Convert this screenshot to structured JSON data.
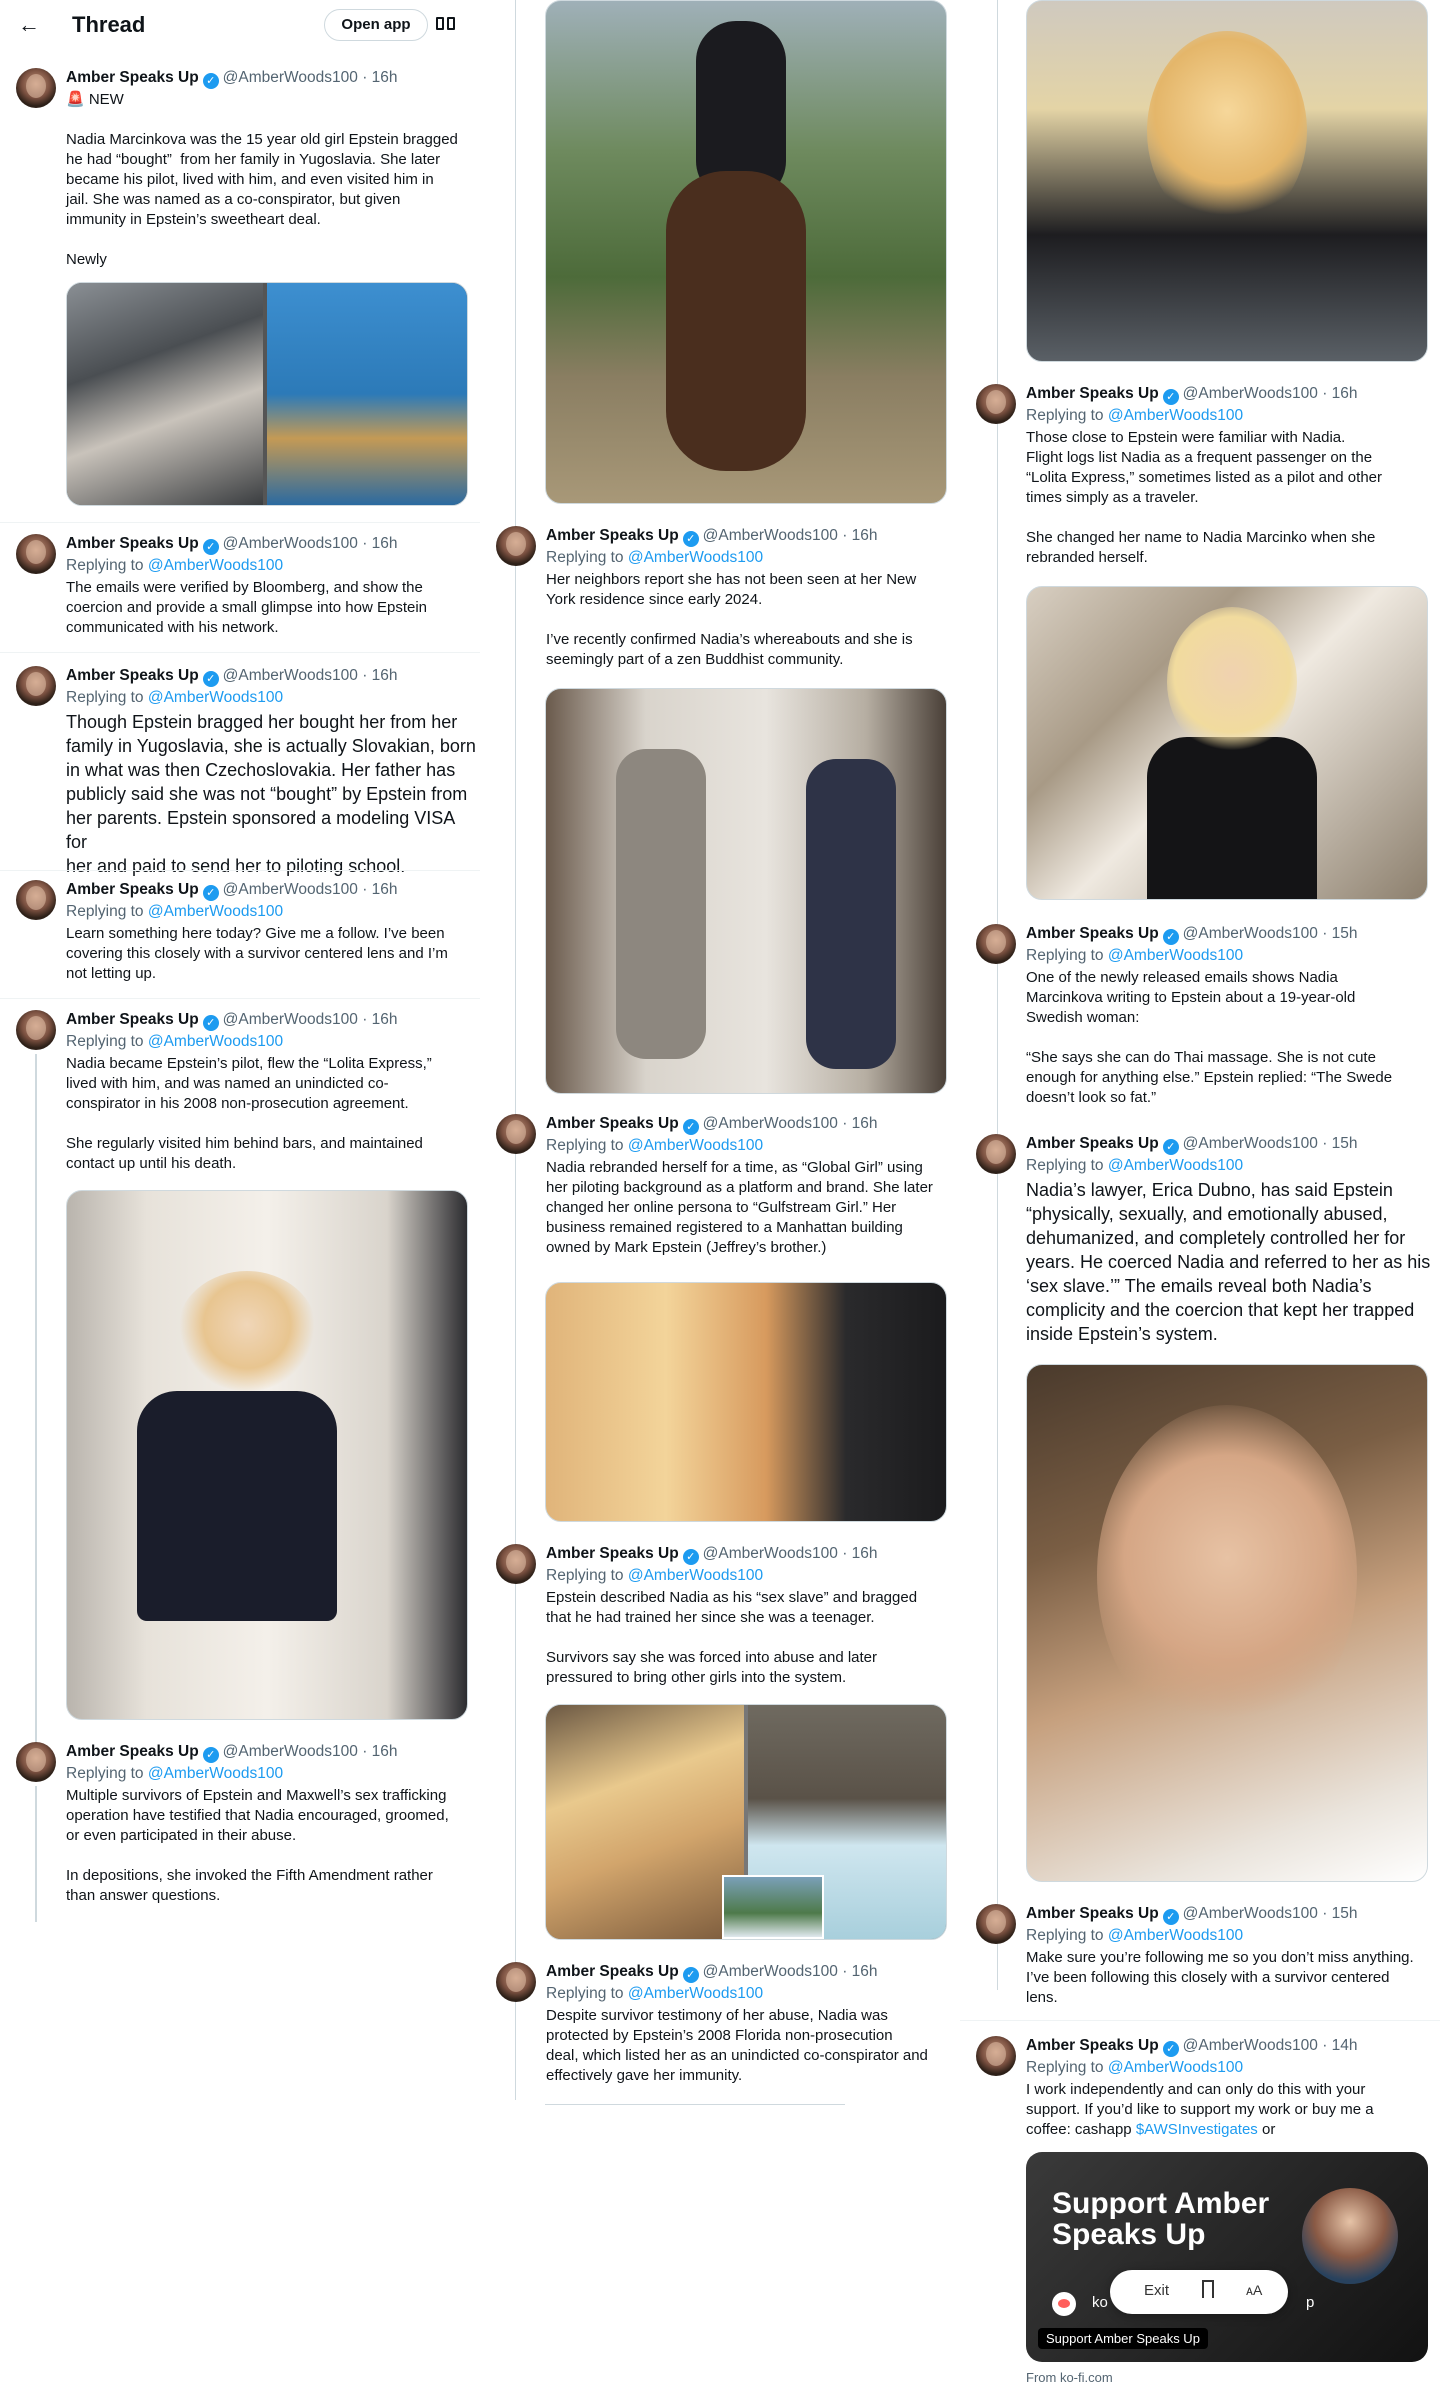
{
  "header": {
    "title": "Thread",
    "open_app": "Open app",
    "back_icon": "arrow-left-icon",
    "reader_icon": "reader-mode-icon"
  },
  "author": {
    "name": "Amber Speaks Up",
    "handle": "@AmberWoods100",
    "verified": true,
    "replying_prefix": "Replying to",
    "replying_handle": "@AmberWoods100"
  },
  "tweets": [
    {
      "time": "16h",
      "badge": "🚨 NEW",
      "text": "Nadia Marcinkova was the 15 year old girl Epstein bragged\nhe had “bought”  from her family in Yugoslavia. She later\nbecame his pilot, lived with him, and even visited him in\njail. She was named as a co-conspirator, but given\nimmunity in Epstein’s sweetheart deal.\n\nNewly"
    },
    {
      "time": "16h",
      "text": "The emails were verified by Bloomberg, and show the\ncoercion and provide a small glimpse into how Epstein\ncommunicated with his network."
    },
    {
      "time": "16h",
      "text": "Though Epstein bragged her bought her from her\nfamily in Yugoslavia, she is actually Slovakian, born\nin what was then Czechoslovakia. Her father has\npublicly said she was not “bought” by Epstein from\nher parents. Epstein sponsored a modeling VISA for\nher and paid to send her to piloting school."
    },
    {
      "time": "16h",
      "text": "Learn something here today? Give me a follow. I’ve been\ncovering this closely with a survivor centered lens and I’m\nnot letting up."
    },
    {
      "time": "16h",
      "text": "Nadia became Epstein’s pilot, flew the “Lolita Express,”\nlived with him, and was named an unindicted co-\nconspirator in his 2008 non-prosecution agreement.\n\nShe regularly visited him behind bars, and maintained\ncontact up until his death."
    },
    {
      "time": "16h",
      "text": "Multiple survivors of Epstein and Maxwell’s sex trafficking\noperation have testified that Nadia encouraged, groomed,\nor even participated in their abuse.\n\nIn depositions, she invoked the Fifth Amendment rather\nthan answer questions."
    },
    {
      "time": "16h",
      "text": "Her neighbors report she has not been seen at her New\nYork residence since early 2024.\n\nI’ve recently confirmed Nadia’s whereabouts and she is\nseemingly part of a zen Buddhist community."
    },
    {
      "time": "16h",
      "text": "Nadia rebranded herself for a time, as “Global Girl” using\nher piloting background as a platform and brand. She later\nchanged her online persona to “Gulfstream Girl.” Her\nbusiness remained registered to a Manhattan building\nowned by Mark Epstein (Jeffrey’s brother.)"
    },
    {
      "time": "16h",
      "text": "Epstein described Nadia as his “sex slave” and bragged\nthat he had trained her since she was a teenager.\n\nSurvivors say she was forced into abuse and later\npressured to bring other girls into the system."
    },
    {
      "time": "16h",
      "text": "Despite survivor testimony of her abuse, Nadia was\nprotected by Epstein’s 2008 Florida non-prosecution\ndeal, which listed her as an unindicted co-conspirator and\neffectively gave her immunity."
    },
    {
      "time": "16h",
      "text": "Those close to Epstein were familiar with Nadia.\nFlight logs list Nadia as a frequent passenger on the\n“Lolita Express,” sometimes listed as a pilot and other\ntimes simply as a traveler.\n\nShe changed her name to Nadia Marcinko when she\nrebranded herself."
    },
    {
      "time": "15h",
      "text": "One of the newly released emails shows Nadia\nMarcinkova writing to Epstein about a 19-year-old\nSwedish woman:\n\n“She says she can do Thai massage. She is not cute\nenough for anything else.” Epstein replied: “The Swede\ndoesn’t look so fat.”"
    },
    {
      "time": "15h",
      "text": "Nadia’s lawyer, Erica Dubno, has said Epstein\n“physically, sexually, and emotionally abused,\ndehumanized, and completely controlled her for\nyears. He coerced Nadia and referred to her as his\n‘sex slave.’” The emails reveal both Nadia’s\ncomplicity and the coercion that kept her trapped\ninside Epstein’s system."
    },
    {
      "time": "15h",
      "text": "Make sure you’re following me so you don’t miss anything.\nI’ve been following this closely with a survivor centered\nlens."
    },
    {
      "time": "14h",
      "text": "I work independently and can only do this with your\nsupport. If you’d like to support my work or buy me a\ncoffee: cashapp ",
      "cashtag": "$AWSInvestigates",
      "text_end": " or"
    }
  ],
  "kofi_card": {
    "title": "Support Amber Speaks Up",
    "ko_text": "ko",
    "p_text": "p",
    "caption": "Support Amber Speaks Up",
    "from": "From ko-fi.com"
  },
  "reader_pill": {
    "exit": "Exit",
    "bookmark_icon": "bookmark-icon",
    "text_size": "ᴀA"
  },
  "colors": {
    "link": "#1d9bf0",
    "secondary": "#536471",
    "border": "#cfd9de"
  }
}
